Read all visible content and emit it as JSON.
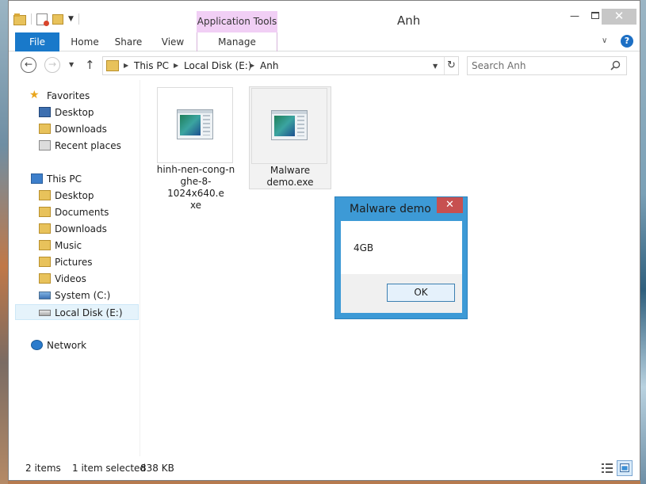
{
  "window": {
    "title": "Anh",
    "context_tab_group": "Application Tools",
    "close_glyph": "✕",
    "min_glyph": "—"
  },
  "ribbon": {
    "tabs": [
      {
        "label": "File"
      },
      {
        "label": "Home"
      },
      {
        "label": "Share"
      },
      {
        "label": "View"
      },
      {
        "label": "Manage"
      }
    ],
    "help_glyph": "?"
  },
  "navigation": {
    "breadcrumb": [
      "This PC",
      "Local Disk (E:)",
      "Anh"
    ],
    "search_placeholder": "Search Anh"
  },
  "sidebar": {
    "favorites": {
      "label": "Favorites",
      "items": [
        {
          "label": "Desktop",
          "icon": "desktop-icon"
        },
        {
          "label": "Downloads",
          "icon": "downloads-folder-icon"
        },
        {
          "label": "Recent places",
          "icon": "recent-places-icon"
        }
      ]
    },
    "this_pc": {
      "label": "This PC",
      "items": [
        {
          "label": "Desktop",
          "icon": "folder-icon"
        },
        {
          "label": "Documents",
          "icon": "folder-icon"
        },
        {
          "label": "Downloads",
          "icon": "folder-icon"
        },
        {
          "label": "Music",
          "icon": "folder-icon"
        },
        {
          "label": "Pictures",
          "icon": "folder-icon"
        },
        {
          "label": "Videos",
          "icon": "folder-icon"
        },
        {
          "label": "System (C:)",
          "icon": "system-drive-icon"
        },
        {
          "label": "Local Disk (E:)",
          "icon": "local-disk-icon",
          "selected": true
        }
      ]
    },
    "network": {
      "label": "Network"
    }
  },
  "files": [
    {
      "name_lines": [
        "hinh-nen-cong-n",
        "ghe-8-1024x640.e",
        "xe"
      ],
      "selected": false
    },
    {
      "name_lines": [
        "Malware",
        "demo.exe"
      ],
      "selected": true
    }
  ],
  "status": {
    "item_count": "2 items",
    "selection": "1 item selected",
    "size": "838 KB"
  },
  "dialog": {
    "title": "Malware demo",
    "message": "4GB",
    "ok_label": "OK",
    "close_glyph": "✕"
  },
  "colors": {
    "file_tab": "#1979ca",
    "context_tab": "#f1cff5",
    "dialog_frame": "#3d9ad6",
    "dialog_close": "#c75050"
  }
}
